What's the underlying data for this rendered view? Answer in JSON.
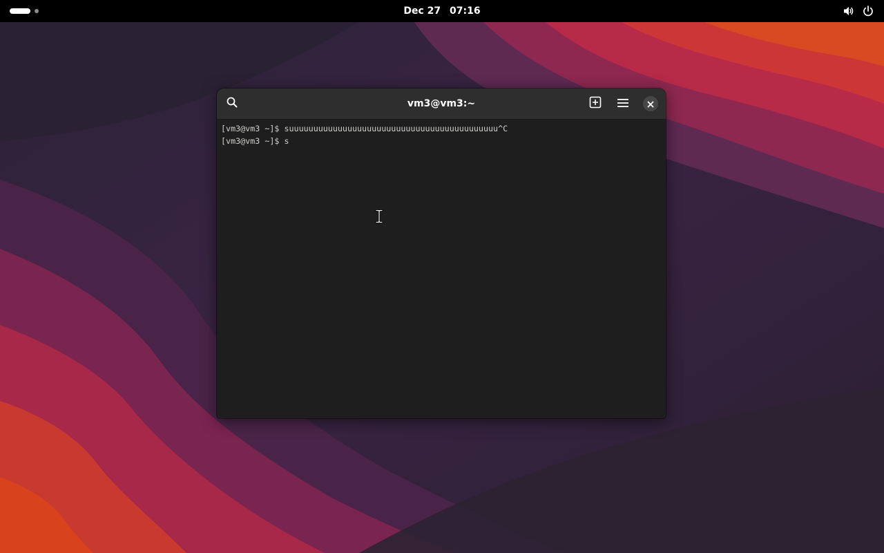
{
  "topbar": {
    "date": "Dec 27",
    "time": "07:16",
    "volume_icon": "speaker-volume-icon",
    "power_icon": "power-icon",
    "activities_icon": "workspace-indicator"
  },
  "terminal_window": {
    "title": "vm3@vm3:~",
    "search_icon": "search-icon",
    "new_tab_icon": "new-tab-icon",
    "menu_icon": "hamburger-menu-icon",
    "close_icon": "close-icon",
    "lines": [
      "[vm3@vm3 ~]$ suuuuuuuuuuuuuuuuuuuuuuuuuuuuuuuuuuuuuuuuuuu^C",
      "[vm3@vm3 ~]$ s"
    ]
  },
  "colors": {
    "topbar_bg": "#000000",
    "headerbar_bg": "#2e2e2e",
    "terminal_bg": "#1e1e1e",
    "terminal_fg": "#d0cfcc",
    "wallpaper_orange": "#d8401c",
    "wallpaper_magenta": "#a42a4c",
    "wallpaper_dark": "#2a2036"
  }
}
